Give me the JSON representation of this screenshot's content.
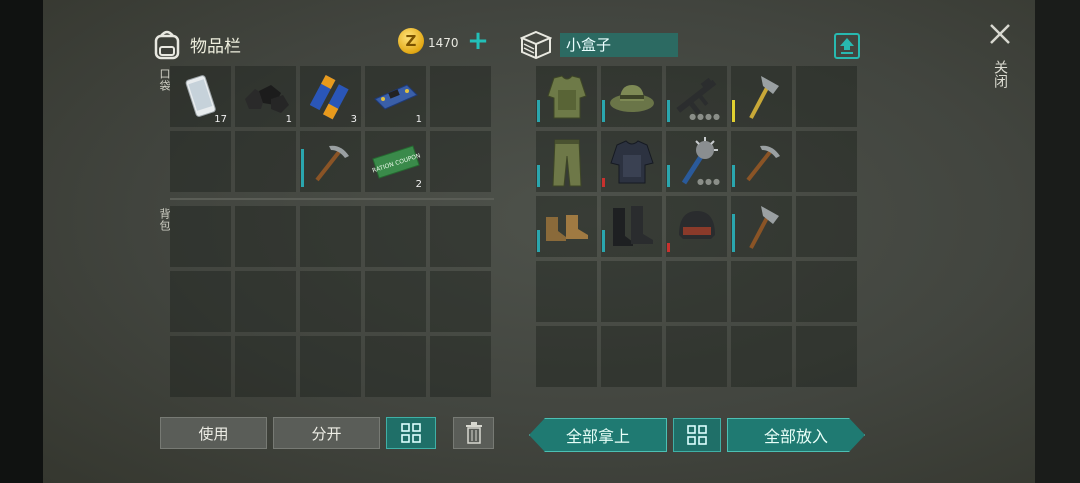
{
  "inventory": {
    "title": "物品栏",
    "coins": "1470",
    "pocket_label": "口袋",
    "backpack_label": "背包",
    "pocket_items": [
      {
        "name": "phone",
        "count": "17"
      },
      {
        "name": "coal",
        "count": "1"
      },
      {
        "name": "batteries",
        "count": "3"
      },
      {
        "name": "circuit-board",
        "count": "1"
      },
      {
        "name": "",
        "count": ""
      },
      {
        "name": "",
        "count": ""
      },
      {
        "name": "",
        "count": ""
      },
      {
        "name": "pickaxe",
        "count": ""
      },
      {
        "name": "ration-coupon",
        "count": "2",
        "coupon_text": "RATION COUPON"
      },
      {
        "name": "",
        "count": ""
      }
    ]
  },
  "actions": {
    "use": "使用",
    "split": "分开"
  },
  "box": {
    "name": "小盒子",
    "take_all": "全部拿上",
    "put_all": "全部放入",
    "items": [
      "armor-vest",
      "boonie-hat",
      "assault-rifle",
      "hatchet",
      "",
      "camo-pants",
      "police-armor",
      "spiked-mace",
      "pickaxe",
      "",
      "leather-boots",
      "combat-boots",
      "combat-helmet",
      "hatchet",
      ""
    ]
  },
  "close_label": "关闭",
  "colors": {
    "accent": "#1f7a72",
    "teal_bar": "#2aa6ae",
    "red_bar": "#c8312e"
  }
}
